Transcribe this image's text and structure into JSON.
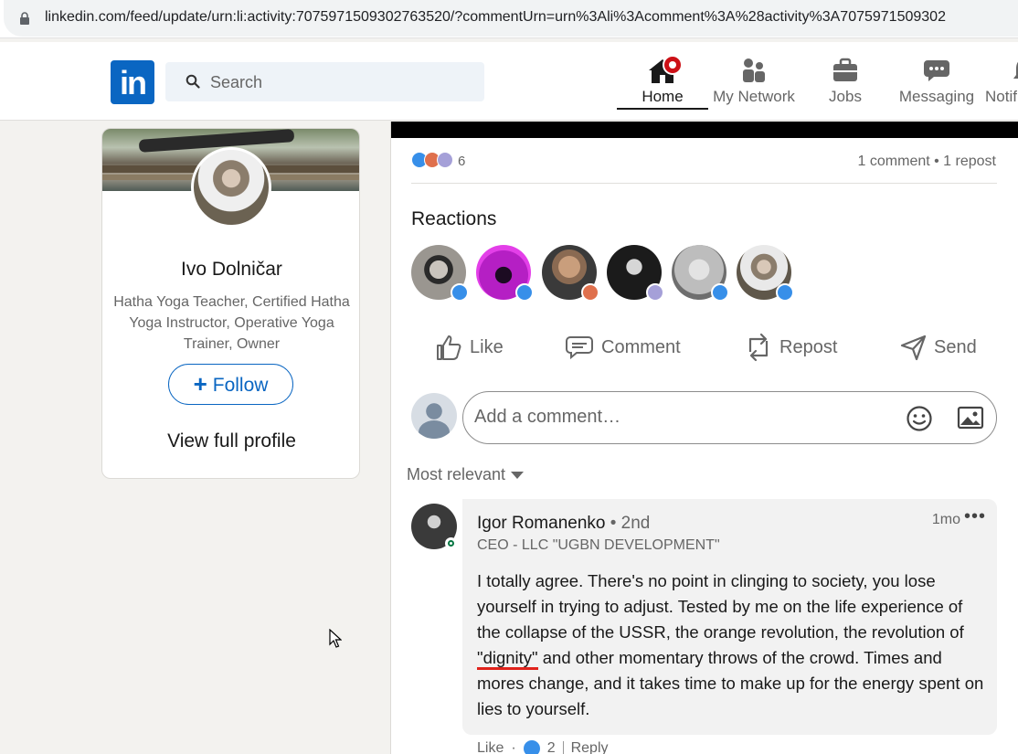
{
  "browser": {
    "url": "linkedin.com/feed/update/urn:li:activity:7075971509302763520/?commentUrn=urn%3Ali%3Acomment%3A%28activity%3A7075971509302"
  },
  "nav": {
    "logo_text": "in",
    "search_placeholder": "Search",
    "items": [
      {
        "label": "Home",
        "icon": "home-icon",
        "active": true
      },
      {
        "label": "My Network",
        "icon": "network-icon"
      },
      {
        "label": "Jobs",
        "icon": "briefcase-icon"
      },
      {
        "label": "Messaging",
        "icon": "messaging-icon"
      },
      {
        "label": "Notif",
        "icon": "bell-icon"
      }
    ]
  },
  "profile": {
    "name": "Ivo Dolničar",
    "headline": "Hatha Yoga Teacher, Certified Hatha Yoga Instructor, Operative Yoga Trainer, Owner",
    "follow_label": "Follow",
    "view_profile_label": "View full profile"
  },
  "post": {
    "reaction_count": "6",
    "meta": "1 comment • 1 repost",
    "reactions_title": "Reactions",
    "reactors": [
      {
        "badge": "like"
      },
      {
        "badge": "like"
      },
      {
        "badge": "love"
      },
      {
        "badge": "support"
      },
      {
        "badge": "like"
      },
      {
        "badge": "like"
      }
    ],
    "actions": {
      "like": "Like",
      "comment": "Comment",
      "repost": "Repost",
      "send": "Send"
    },
    "comment_placeholder": "Add a comment…",
    "sort_label": "Most relevant"
  },
  "comment": {
    "author": "Igor Romanenko",
    "degree": " • 2nd",
    "title": "CEO - LLC \"UGBN DEVELOPMENT\"",
    "time": "1mo",
    "more": "•••",
    "text_before": "I totally agree. There's no point in clinging to society, you lose yourself in trying to adjust. Tested by me on the life experience of the collapse of the USSR, the orange revolution, the revolution of",
    "text_highlight": "\"dignity\"",
    "text_after": " and other momentary throws of the crowd. Times and mores change, and it takes time to make up for the energy spent on lies to yourself.",
    "footer_like": "Like",
    "footer_dot": "·",
    "footer_count": "2",
    "footer_reply": "Reply"
  },
  "colors": {
    "brand": "#0a66c2",
    "like": "#378fe9",
    "love": "#df704d",
    "notification": "#cc1016",
    "annotation_underline": "#e0231c"
  }
}
